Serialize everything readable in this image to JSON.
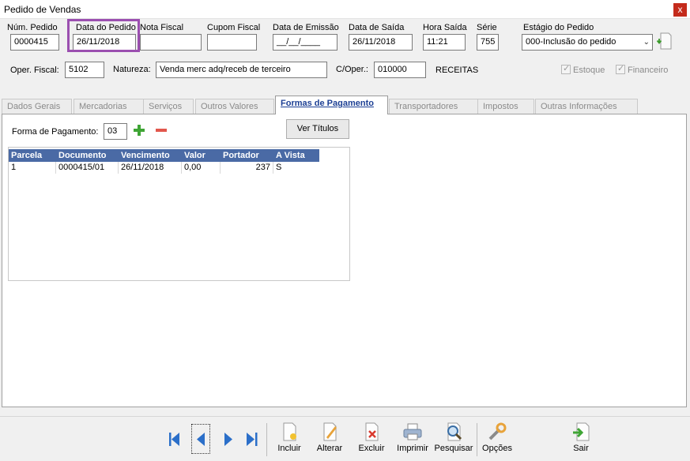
{
  "window": {
    "title": "Pedido de Vendas",
    "close_glyph": "x"
  },
  "header": {
    "num_pedido": {
      "label": "Núm. Pedido",
      "value": "0000415"
    },
    "data_pedido": {
      "label": "Data do Pedido",
      "value": "26/11/2018"
    },
    "nota_fiscal": {
      "label": "Nota Fiscal",
      "value": ""
    },
    "cupom_fiscal": {
      "label": "Cupom Fiscal",
      "value": ""
    },
    "data_emissao": {
      "label": "Data de Emissão",
      "value": "__/__/____"
    },
    "data_saida": {
      "label": "Data de Saída",
      "value": "26/11/2018"
    },
    "hora_saida": {
      "label": "Hora Saída",
      "value": "11:21"
    },
    "serie": {
      "label": "Série",
      "value": "755"
    },
    "estagio": {
      "label": "Estágio do Pedido",
      "value": "000-Inclusão do pedido"
    },
    "oper_fiscal": {
      "label": "Oper. Fiscal:",
      "value": "5102"
    },
    "natureza": {
      "label": "Natureza:",
      "value": "Venda merc adq/receb de terceiro"
    },
    "c_oper": {
      "label": "C/Oper.:",
      "value": "010000"
    },
    "receitas": "RECEITAS",
    "estoque": {
      "label": "Estoque",
      "checked": true
    },
    "financeiro": {
      "label": "Financeiro",
      "checked": true
    }
  },
  "tabs": [
    {
      "label": "Dados Gerais"
    },
    {
      "label": "Mercadorias"
    },
    {
      "label": "Serviços"
    },
    {
      "label": "Outros Valores"
    },
    {
      "label": "Formas de Pagamento"
    },
    {
      "label": "Transportadores"
    },
    {
      "label": "Impostos"
    },
    {
      "label": "Outras Informações"
    }
  ],
  "payment": {
    "forma_label": "Forma de Pagamento:",
    "forma_value": "03",
    "ver_titulos": "Ver Títulos",
    "columns": [
      "Parcela",
      "Documento",
      "Vencimento",
      "Valor",
      "Portador",
      "A Vista"
    ],
    "rows": [
      [
        "1",
        "0000415/01",
        "26/11/2018",
        "0,00",
        "237",
        "S"
      ]
    ]
  },
  "toolbar": {
    "incluir": "Incluir",
    "alterar": "Alterar",
    "excluir": "Excluir",
    "imprimir": "Imprimir",
    "pesquisar": "Pesquisar",
    "opcoes": "Opções",
    "sair": "Sair"
  },
  "colors": {
    "highlight": "#9b4fb0",
    "grid_header": "#4a6aa5",
    "active_tab_text": "#1c3f94"
  }
}
